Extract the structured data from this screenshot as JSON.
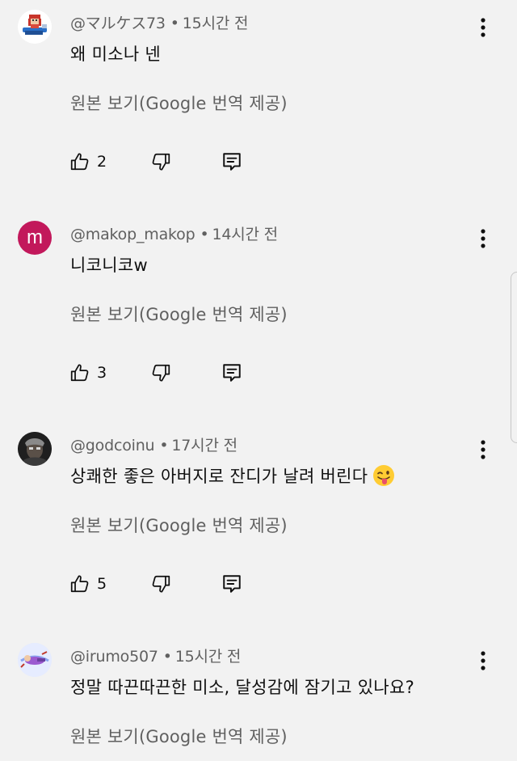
{
  "comments": [
    {
      "author": "@マルケス73",
      "time": "15시간 전",
      "text": "왜 미소나 넨",
      "translate_label": "원본 보기(Google 번역 제공)",
      "likes": "2",
      "avatar": "pixel-character-avatar"
    },
    {
      "author": "@makop_makop",
      "time": "14시간 전",
      "text": "니코니코w",
      "translate_label": "원본 보기(Google 번역 제공)",
      "likes": "3",
      "avatar_letter": "m",
      "avatar_color": "#c2185b"
    },
    {
      "author": "@godcoinu",
      "time": "17시간 전",
      "text": "상쾌한 좋은 아버지로 잔디가 날려 버린다",
      "emoji": "winking-face-with-tongue",
      "translate_label": "원본 보기(Google 번역 제공)",
      "likes": "5",
      "avatar": "dark-photo-avatar"
    },
    {
      "author": "@irumo507",
      "time": "15시간 전",
      "text": "정말 따끈따끈한 미소, 달성감에 잠기고 있나요?",
      "translate_label": "원본 보기(Google 번역 제공)",
      "avatar": "skydiver-avatar"
    }
  ],
  "separator": "•",
  "icons": {
    "like": "thumbs-up-icon",
    "dislike": "thumbs-down-icon",
    "reply": "reply-comment-icon",
    "more": "more-vertical-icon"
  },
  "colors": {
    "background": "#f2f2f2",
    "primary_text": "#0f0f0f",
    "secondary_text": "#606060"
  }
}
